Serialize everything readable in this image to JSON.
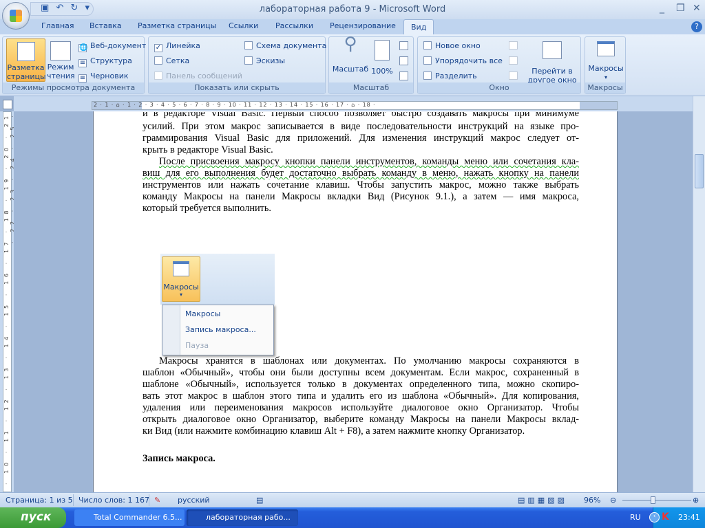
{
  "window": {
    "title": "лабораторная работа 9 - Microsoft Word",
    "controls": [
      "_",
      "❐",
      "✕"
    ]
  },
  "qat": {
    "save": "save-icon",
    "undo": "undo-icon",
    "redo": "redo-icon",
    "customize": "▾"
  },
  "tabs": [
    {
      "label": "Главная"
    },
    {
      "label": "Вставка"
    },
    {
      "label": "Разметка страницы"
    },
    {
      "label": "Ссылки"
    },
    {
      "label": "Рассылки"
    },
    {
      "label": "Рецензирование"
    },
    {
      "label": "Вид",
      "active": true
    }
  ],
  "help": "?",
  "ribbon": {
    "views": {
      "label": "Режимы просмотра документа",
      "print_layout": "Разметка страницы",
      "print_layout_l1": "Разметка",
      "print_layout_l2": "страницы",
      "reading_l1": "Режим",
      "reading_l2": "чтения",
      "web": "Веб-документ",
      "outline": "Структура",
      "draft": "Черновик"
    },
    "show": {
      "label": "Показать или скрыть",
      "ruler": "Линейка",
      "ruler_checked": true,
      "gridlines": "Сетка",
      "gridlines_checked": false,
      "message_bar": "Панель сообщений",
      "doc_map": "Схема документа",
      "doc_map_checked": false,
      "thumbnails": "Эскизы",
      "thumbnails_checked": false
    },
    "zoom": {
      "label": "Масштаб",
      "zoom": "Масштаб",
      "hundred": "100%"
    },
    "window": {
      "label": "Окно",
      "new_window": "Новое окно",
      "arrange_all": "Упорядочить все",
      "split": "Разделить",
      "switch_l1": "Перейти в",
      "switch_l2": "другое окно ▾"
    },
    "macros": {
      "label": "Макросы",
      "button": "Макросы"
    }
  },
  "ruler": {
    "ticks": "2 · 1 · ⌂ · 1 · 2 · 3 · 4 · 5 · 6 · 7 · 8 · 9 · 10 · 11 · 12 · 13 · 14 · 15 · 16 · 17 · ⌂ · 18 ·",
    "vticks": "· 10 · 11 · 12 · 13 · 14 · 15 · 16 · 17 · 18 · 19 · 20 · 21 · 22 · 23 · 24 · 25 ·"
  },
  "document": {
    "para1": [
      "и в редакторе Visual Basic. Первый способ позволяет быстро создавать макросы при минимуме",
      "усилий. При этом макрос записывается в виде последовательности инструкций на языке про-",
      "граммирования Visual Basic для приложений. Для изменения инструкций макрос следует от-",
      "крыть в редакторе Visual Basic."
    ],
    "para2": [
      "После присвоения макросу кнопки панели инструментов, команды меню или сочетания кла-",
      "виш для его выполнения будет достаточно выбрать команду в меню, нажать кнопку на панели",
      "инструментов или нажать сочетание клавиш. Чтобы запустить макрос, можно также выбрать",
      "команду Макросы на панели Макросы вкладки Вид (Рисунок 9.1.), а затем — имя макроса,",
      "который требуется выполнить."
    ],
    "figure": {
      "button": "Макросы",
      "menu": [
        "Макросы",
        "Запись макроса...",
        "Пауза"
      ]
    },
    "para3": [
      "Макросы хранятся в шаблонах или документах. По умолчанию макросы сохраняются в",
      "шаблон «Обычный», чтобы они были доступны всем документам. Если макрос, сохраненный в",
      "шаблоне «Обычный», используется только в документах определенного типа, можно скопиро-",
      "вать этот макрос в шаблон этого типа и удалить его из шаблона «Обычный». Для копирования,",
      "удаления или переименования макросов используйте диалоговое окно Организатор. Чтобы",
      "открыть диалоговое окно Организатор, выберите команду Макросы на панели Макросы вклад-",
      "ки Вид (или нажмите комбинацию клавиш Alt + F8), а затем нажмите кнопку Организатор."
    ],
    "heading": "Запись макроса."
  },
  "status": {
    "page": "Страница: 1 из 5",
    "words": "Число слов: 1 167",
    "language": "русский",
    "zoom": "96%",
    "zoom_percent": 96
  },
  "taskbar": {
    "start": "пуск",
    "tasks": [
      {
        "label": "Total Commander 6.5..."
      },
      {
        "label": "лабораторная рабо..."
      }
    ],
    "lang": "RU",
    "clock": "23:41"
  }
}
